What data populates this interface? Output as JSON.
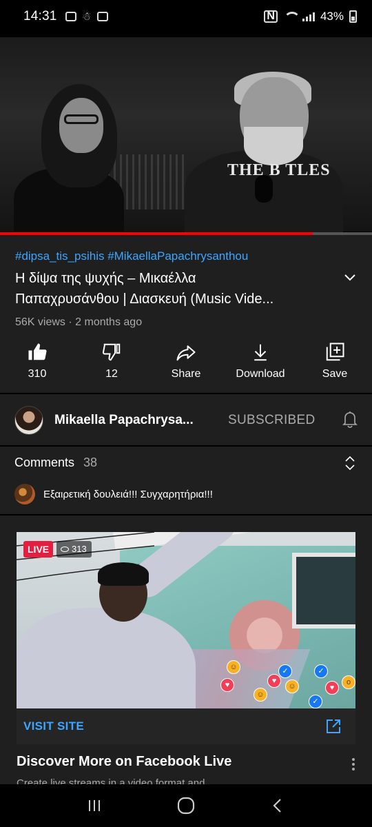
{
  "status_bar": {
    "time": "14:31",
    "battery": "43%"
  },
  "video": {
    "progress": 0.84,
    "accent_color": "#ff0000"
  },
  "info": {
    "hashtags": "#dipsa_tis_psihis #MikaellaPapachrysanthou",
    "title_line1": "Η δίψα της ψυχής – Μικαέλλα",
    "title_line2": "Παπαχρυσάνθου | Διασκευή (Music Vide...",
    "meta": "56K views · 2 months ago"
  },
  "actions": {
    "like": "310",
    "dislike": "12",
    "share": "Share",
    "download": "Download",
    "save": "Save"
  },
  "channel": {
    "name": "Mikaella Papachrysa...",
    "subscribe_state": "SUBSCRIBED"
  },
  "comments": {
    "label": "Comments",
    "count": "38",
    "top_comment": "Εξαιρετική δουλειά!!! Συγχαρητήρια!!!"
  },
  "ad": {
    "live_label": "LIVE",
    "viewers": "313",
    "visit_label": "VISIT SITE",
    "title": "Discover More on Facebook Live",
    "subtitle": "Create live streams in a video format and"
  },
  "colors": {
    "link_blue": "#3ea6ff",
    "background": "#1f1f1f",
    "live_red": "#e41e3f"
  }
}
